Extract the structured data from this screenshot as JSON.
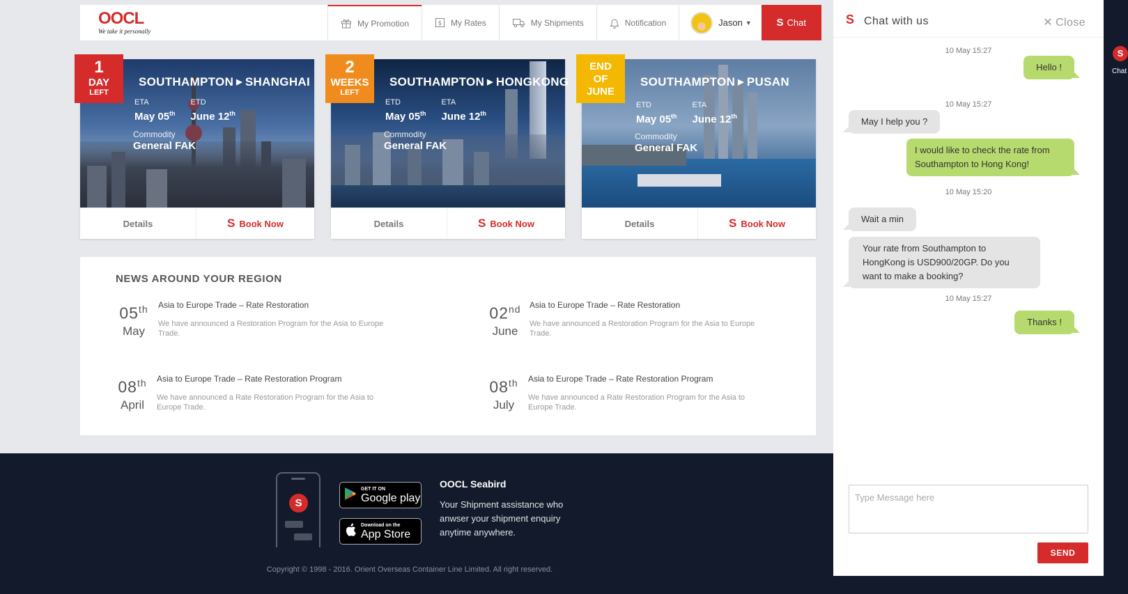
{
  "header": {
    "logo": "OOCL",
    "tagline": "We take it personally",
    "nav": [
      {
        "label": "My Promotion",
        "icon": "gift-icon"
      },
      {
        "label": "My Rates",
        "icon": "rates-icon"
      },
      {
        "label": "My Shipments",
        "icon": "truck-icon"
      },
      {
        "label": "Notification",
        "icon": "bell-icon"
      }
    ],
    "user_name": "Jason",
    "chat_label": "Chat"
  },
  "promotions": [
    {
      "badge": [
        "1",
        "DAY",
        "LEFT"
      ],
      "badge_color": "#d52b2b",
      "origin": "SOUTHAMPTON",
      "destination": "SHANGHAI",
      "etd_label": "ETA",
      "etd_day": "May 05",
      "etd_sup": "th",
      "eta_label": "ETD",
      "eta_day": "June 12",
      "eta_sup": "th",
      "commodity_label": "Commodity",
      "commodity": "General FAK",
      "details_label": "Details",
      "book_label": "Book Now"
    },
    {
      "badge": [
        "2",
        "WEEKS",
        "LEFT"
      ],
      "badge_color": "#f08c1e",
      "origin": "SOUTHAMPTON",
      "destination": "HONGKONG",
      "etd_label": "ETD",
      "etd_day": "May 05",
      "etd_sup": "th",
      "eta_label": "ETA",
      "eta_day": "June 12",
      "eta_sup": "th",
      "commodity_label": "Commodity",
      "commodity": "General FAK",
      "details_label": "Details",
      "book_label": "Book Now"
    },
    {
      "badge": [
        "END",
        "OF",
        "JUNE"
      ],
      "badge_color": "#f5b800",
      "origin": "SOUTHAMPTON",
      "destination": "PUSAN",
      "etd_label": "ETD",
      "etd_day": "May 05",
      "etd_sup": "th",
      "eta_label": "ETA",
      "eta_day": "June 12",
      "eta_sup": "th",
      "commodity_label": "Commodity",
      "commodity": "General FAK",
      "details_label": "Details",
      "book_label": "Book Now"
    }
  ],
  "news": {
    "title": "NEWS AROUND YOUR REGION",
    "items": [
      {
        "day": "05",
        "sup": "th",
        "month": "May",
        "headline": "Asia to Europe Trade – Rate Restoration",
        "body": "We have announced a Restoration Program for the Asia to Europe Trade."
      },
      {
        "day": "02",
        "sup": "nd",
        "month": "June",
        "headline": "Asia to Europe Trade – Rate Restoration",
        "body": "We have announced a Restoration Program for the Asia to Europe Trade."
      },
      {
        "day": "08",
        "sup": "th",
        "month": "April",
        "headline": "Asia to Europe Trade – Rate Restoration Program",
        "body": "We have announced a Rate Restoration Program for the Asia to Europe Trade."
      },
      {
        "day": "08",
        "sup": "th",
        "month": "July",
        "headline": "Asia to Europe Trade – Rate Restoration Program",
        "body": "We have announced a Rate Restoration Program for the Asia to Europe Trade."
      }
    ]
  },
  "footer": {
    "google_small": "GET IT ON",
    "google_big": "Google play",
    "apple_small": "Download on the",
    "apple_big": "App Store",
    "app_title": "OOCL Seabird",
    "app_desc": "Your Shipment assistance who anwser your shipment enquiry anytime anywhere.",
    "copyright": "Copyright © 1998 - 2016. Orient Overseas Container Line Limited. All right reserved."
  },
  "chat": {
    "title": "Chat with us",
    "close_label": "Close",
    "messages": [
      {
        "stamp": "10 May 15:27",
        "from": "me",
        "text": "Hello !"
      },
      {
        "stamp": "10 May 15:27",
        "from": "them",
        "text": "May I help you ?"
      },
      {
        "from": "me",
        "text": "I would like to check the rate from Southampton to Hong Kong!"
      },
      {
        "stamp": "10 May 15:20",
        "from": "them",
        "text": "Wait a min"
      },
      {
        "from": "them",
        "text": "Your rate from Southampton to HongKong is USD900/20GP. Do you want to make a booking?"
      },
      {
        "stamp": "10 May 15:27",
        "from": "me",
        "text": "Thanks !"
      }
    ],
    "input_placeholder": "Type Message here",
    "send_label": "SEND"
  },
  "side_tab": {
    "label": "Chat"
  },
  "colors": {
    "accent": "#d52b2b",
    "bubble_me": "#b7da6f",
    "bubble_them": "#e4e4e4",
    "footer_bg": "#121a2c"
  }
}
